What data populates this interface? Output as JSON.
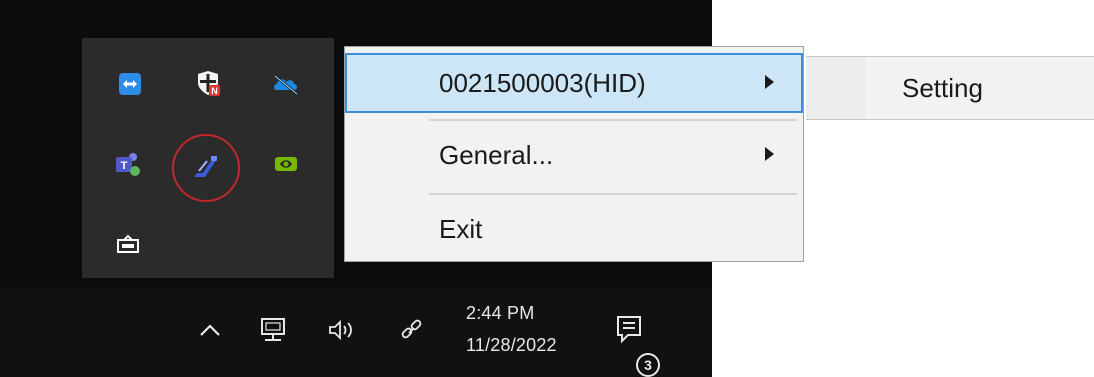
{
  "tray": {
    "icons": [
      {
        "name": "teamviewer-icon",
        "color": "#2d8ce8"
      },
      {
        "name": "security-shield-icon",
        "color": "#e03232"
      },
      {
        "name": "onedrive-icon",
        "color": "#1e88e5"
      },
      {
        "name": "teams-icon",
        "color": "#6264a7"
      },
      {
        "name": "scanner-icon",
        "color": "#3a5bd9"
      },
      {
        "name": "nvidia-icon",
        "color": "#76b900"
      },
      {
        "name": "tray-app-icon",
        "color": "#ffffff"
      }
    ],
    "highlight_color": "#c0272d"
  },
  "context_menu": {
    "items": [
      {
        "label": "0021500003(HID)",
        "has_submenu": true,
        "selected": true
      },
      {
        "label": "General...",
        "has_submenu": true,
        "selected": false
      },
      {
        "label": "Exit",
        "has_submenu": false,
        "selected": false
      }
    ],
    "selection_color": "#cde6f7",
    "selection_border": "#3c8ed6"
  },
  "submenu": {
    "items": [
      {
        "label": "Setting"
      }
    ]
  },
  "taskbar": {
    "icons": [
      "chevron-up-icon",
      "network-icon",
      "volume-icon",
      "link-icon",
      "notification-icon"
    ],
    "clock": {
      "time": "2:44 PM",
      "date": "11/28/2022"
    },
    "notification_count": "3"
  }
}
